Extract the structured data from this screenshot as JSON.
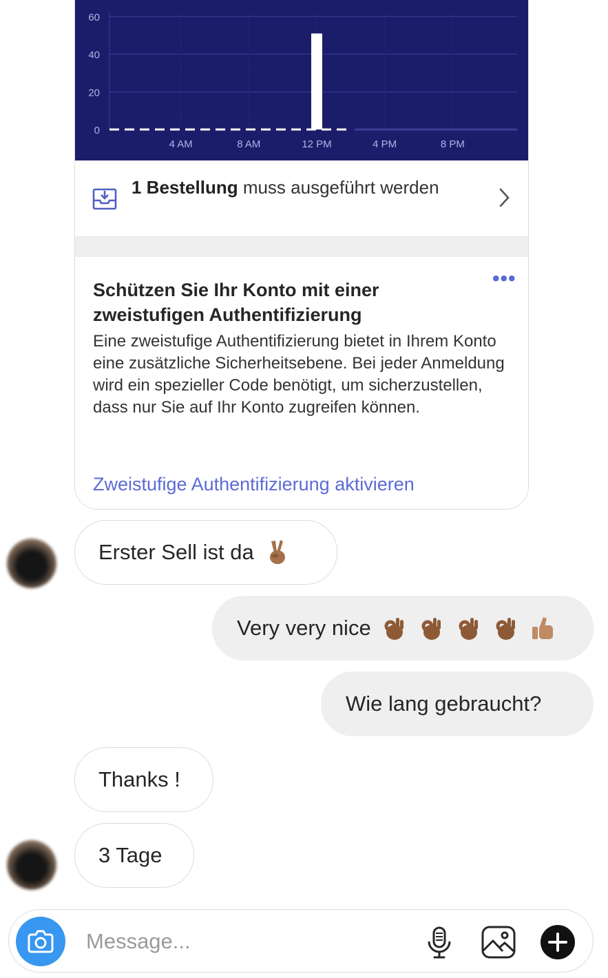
{
  "chart_data": {
    "type": "bar",
    "y_ticks": [
      "60",
      "40",
      "20",
      "0"
    ],
    "ylim": [
      0,
      60
    ],
    "x_ticks": [
      "4 AM",
      "8 AM",
      "12 PM",
      "4 PM",
      "8 PM"
    ],
    "hours": [
      0,
      1,
      2,
      3,
      4,
      5,
      6,
      7,
      8,
      9,
      10,
      11,
      12,
      13,
      14,
      15,
      16,
      17,
      18,
      19,
      20,
      21,
      22,
      23
    ],
    "values": [
      0,
      0,
      0,
      0,
      0,
      0,
      0,
      0,
      0,
      0,
      0,
      0,
      51,
      0,
      0,
      0,
      0,
      0,
      0,
      0,
      0,
      0,
      0,
      0
    ],
    "baseline": "dashed up to 2 PM",
    "grid": true,
    "colors": {
      "background": "#1b1d6a",
      "bar": "#ffffff",
      "grid": "#3b3f9a",
      "tick": "#aeb3e6"
    }
  },
  "order": {
    "count_bold": "1 Bestellung",
    "rest": " muss ausgeführt werden",
    "icon": "inbox-download-icon",
    "chevron": "chevron-right-icon"
  },
  "tfa": {
    "title": "Schützen Sie Ihr Konto mit einer zweistufigen Authentifizierung",
    "menu": "•••",
    "body": "Eine zweistufige Authentifizierung bietet in Ihrem Konto eine zusätzliche Sicherheitsebene. Bei jeder Anmeldung wird ein spezieller Code benötigt, um sicherzustellen, dass nur Sie auf Ihr Konto zugreifen können.",
    "link": "Zweistufige Authentifizierung aktivieren",
    "link_color": "#5b6bd6"
  },
  "messages": [
    {
      "direction": "incoming",
      "text": "Erster Sell ist da",
      "emoji": [
        "victory-hand-medium-dark"
      ]
    },
    {
      "direction": "outgoing",
      "text": "Very very nice",
      "emoji": [
        "ok-hand-medium-dark",
        "ok-hand-medium-dark",
        "ok-hand-medium-dark",
        "ok-hand-medium-dark",
        "thumbs-up-medium"
      ]
    },
    {
      "direction": "outgoing",
      "text": "Wie lang gebraucht?"
    },
    {
      "direction": "incoming",
      "text": "Thanks !"
    },
    {
      "direction": "incoming",
      "text": "3 Tage"
    }
  ],
  "composer": {
    "placeholder": "Message...",
    "camera_icon": "camera-icon",
    "mic_icon": "microphone-icon",
    "gallery_icon": "gallery-icon",
    "plus_icon": "plus-circle-icon",
    "camera_color": "#3897f0"
  }
}
